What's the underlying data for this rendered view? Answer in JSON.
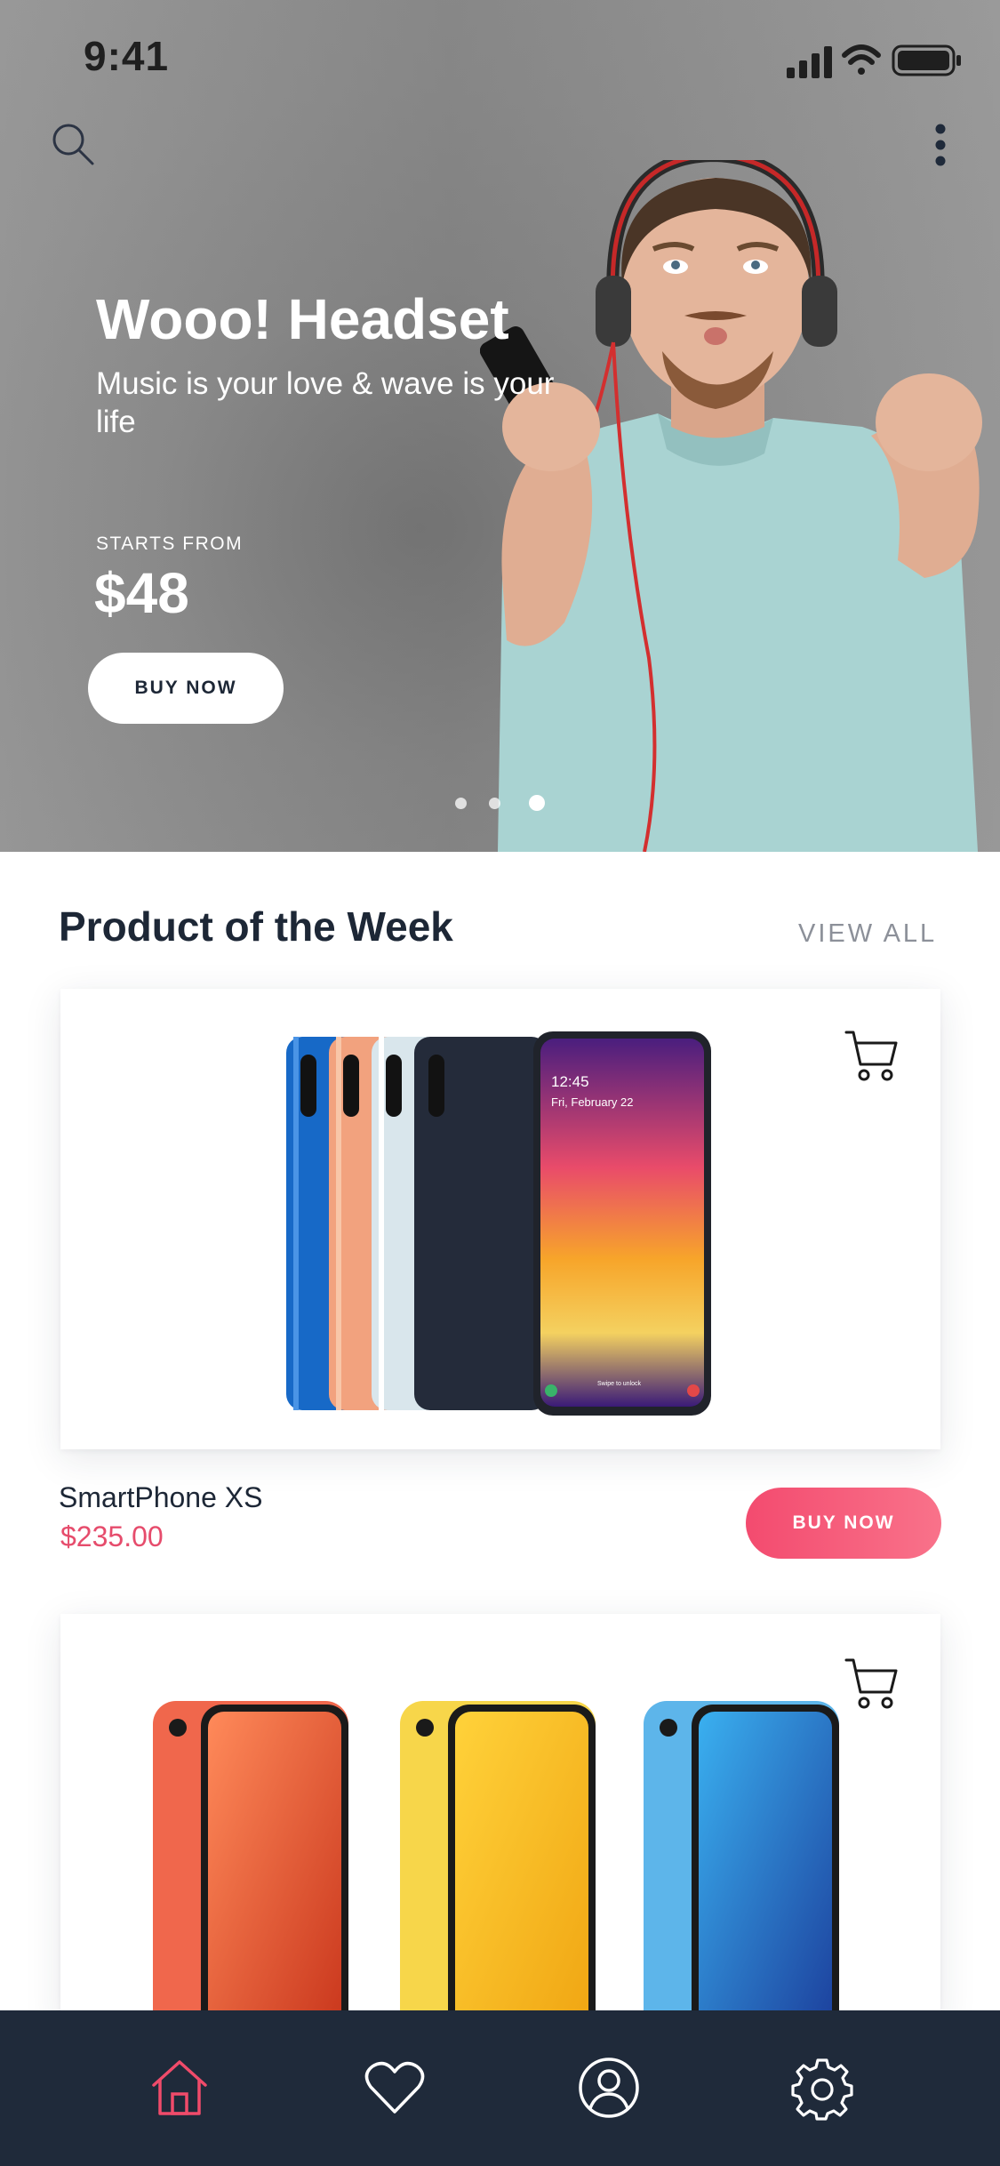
{
  "status_bar": {
    "time": "9:41"
  },
  "hero": {
    "title": "Wooo! Headset",
    "subtitle": "Music is your love & wave is your life",
    "starts_from_label": "STARTS FROM",
    "price": "$48",
    "button_label": "BUY NOW",
    "carousel": {
      "count": 3,
      "active": 3
    }
  },
  "section": {
    "title": "Product of the Week",
    "view_all": "VIEW ALL"
  },
  "products": [
    {
      "name": "SmartPhone XS",
      "price": "$235.00",
      "button_label": "BUY NOW",
      "screen_time": "12:45",
      "screen_date": "Fri, February 22",
      "screen_hint": "Swipe to unlock"
    }
  ],
  "tab_bar": {
    "items": [
      "home",
      "favorites",
      "profile",
      "settings"
    ],
    "active": "home"
  },
  "colors": {
    "accent": "#f34b6f",
    "price": "#e64c6c",
    "navy": "#1f2a3a",
    "muted": "#8c9099"
  }
}
